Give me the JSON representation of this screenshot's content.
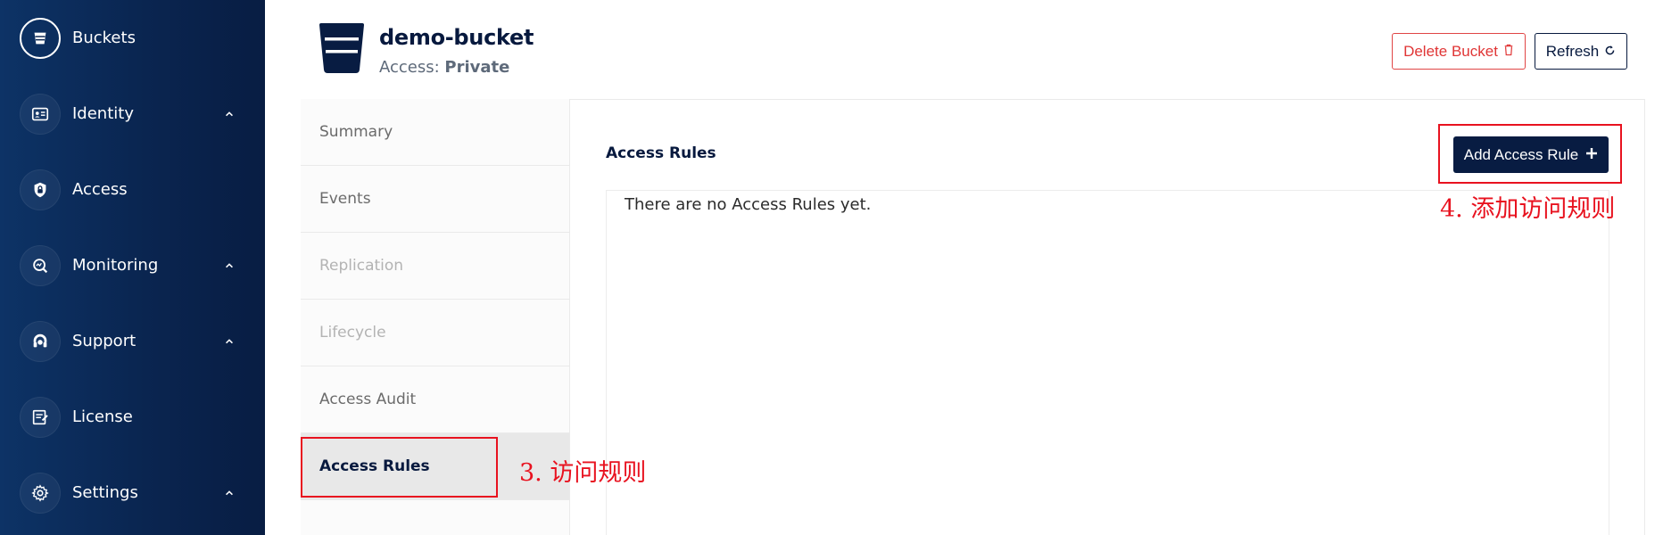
{
  "sidebar": {
    "items": [
      {
        "label": "Buckets",
        "icon": "bucket-icon",
        "active": true,
        "expandable": false
      },
      {
        "label": "Identity",
        "icon": "id-card-icon",
        "expandable": true
      },
      {
        "label": "Access",
        "icon": "lock-shield-icon",
        "expandable": false
      },
      {
        "label": "Monitoring",
        "icon": "monitoring-icon",
        "expandable": true
      },
      {
        "label": "Support",
        "icon": "support-icon",
        "expandable": true
      },
      {
        "label": "License",
        "icon": "license-icon",
        "expandable": false
      },
      {
        "label": "Settings",
        "icon": "gear-icon",
        "expandable": true
      }
    ]
  },
  "header": {
    "bucket_name": "demo-bucket",
    "access_label": "Access:",
    "access_value": "Private",
    "delete_label": "Delete Bucket",
    "refresh_label": "Refresh"
  },
  "tabs": [
    {
      "label": "Summary",
      "state": "normal"
    },
    {
      "label": "Events",
      "state": "normal"
    },
    {
      "label": "Replication",
      "state": "disabled"
    },
    {
      "label": "Lifecycle",
      "state": "disabled"
    },
    {
      "label": "Access Audit",
      "state": "normal"
    },
    {
      "label": "Access Rules",
      "state": "active"
    }
  ],
  "content": {
    "title": "Access Rules",
    "add_label": "Add Access Rule",
    "empty_message": "There are no Access Rules yet."
  },
  "annotations": {
    "step3": "3. 访问规则",
    "step4": "4. 添加访问规则"
  },
  "colors": {
    "sidebar_bg": "#0a2550",
    "primary": "#081c42",
    "danger": "#e03535",
    "annotation": "#e8121f"
  }
}
